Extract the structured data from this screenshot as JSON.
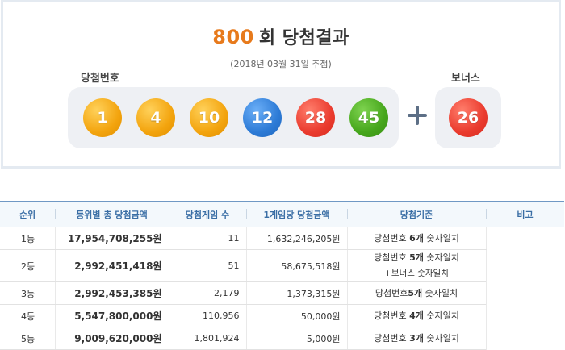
{
  "result": {
    "round_number": "800",
    "round_suffix": "회 당첨결과",
    "draw_date": "(2018년 03월 31일 추첨)",
    "winning_label": "당첨번호",
    "bonus_label": "보너스",
    "balls": [
      {
        "number": "1",
        "color": "yellow"
      },
      {
        "number": "4",
        "color": "yellow"
      },
      {
        "number": "10",
        "color": "yellow"
      },
      {
        "number": "12",
        "color": "blue"
      },
      {
        "number": "28",
        "color": "red"
      },
      {
        "number": "45",
        "color": "green"
      }
    ],
    "bonus_ball": {
      "number": "26",
      "color": "red"
    },
    "colors": {
      "round_number": "#e77a1c",
      "yellow": "#f3a40e",
      "blue": "#2d7bd6",
      "red": "#ea3b2e",
      "green": "#46a61c"
    }
  },
  "table": {
    "headers": [
      "순위",
      "등위별 총 당첨금액",
      "당첨게임 수",
      "1게임당 당첨금액",
      "당첨기준",
      "비고"
    ],
    "rows": [
      {
        "rank": "1등",
        "total": "17,954,708,255원",
        "count": "11",
        "each": "1,632,246,205원",
        "crit_pre": "당첨번호 ",
        "crit_bold": "6개",
        "crit_post": " 숫자일치",
        "crit_line2": ""
      },
      {
        "rank": "2등",
        "total": "2,992,451,418원",
        "count": "51",
        "each": "58,675,518원",
        "crit_pre": "당첨번호 ",
        "crit_bold": "5개",
        "crit_post": " 숫자일치",
        "crit_line2": "+보너스 숫자일치"
      },
      {
        "rank": "3등",
        "total": "2,992,453,385원",
        "count": "2,179",
        "each": "1,373,315원",
        "crit_pre": "당첨번호",
        "crit_bold": "5개",
        "crit_post": " 숫자일치",
        "crit_line2": ""
      },
      {
        "rank": "4등",
        "total": "5,547,800,000원",
        "count": "110,956",
        "each": "50,000원",
        "crit_pre": "당첨번호 ",
        "crit_bold": "4개",
        "crit_post": " 숫자일치",
        "crit_line2": ""
      },
      {
        "rank": "5등",
        "total": "9,009,620,000원",
        "count": "1,801,924",
        "each": "5,000원",
        "crit_pre": "당첨번호 ",
        "crit_bold": "3개",
        "crit_post": " 숫자일치",
        "crit_line2": ""
      }
    ]
  }
}
